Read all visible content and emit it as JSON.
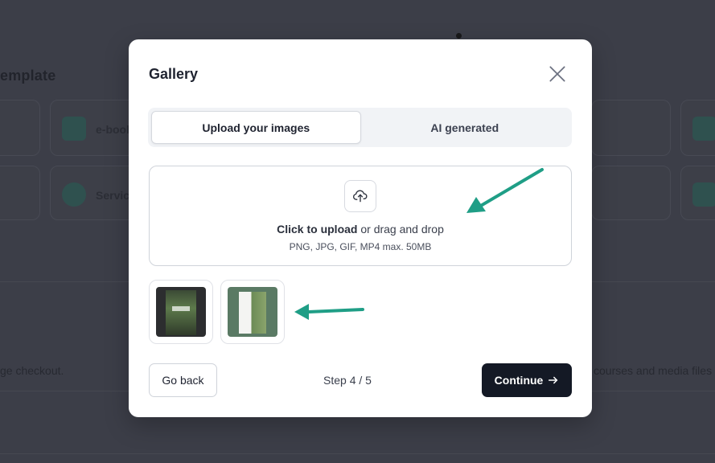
{
  "background": {
    "title": "emplate",
    "cards": [
      {
        "label": "e-book",
        "icon": "pdf-icon"
      },
      {
        "label": "Servic",
        "icon": "dollar-icon"
      }
    ],
    "left_text": "ge checkout.",
    "right_text": "courses and media files"
  },
  "modal": {
    "title": "Gallery",
    "close_icon": "close-icon",
    "tabs": [
      {
        "label": "Upload your images",
        "active": true
      },
      {
        "label": "AI generated",
        "active": false
      }
    ],
    "dropzone": {
      "icon": "cloud-upload-icon",
      "action_text": "Click to upload",
      "rest_text": " or drag and drop",
      "hint": "PNG, JPG, GIF, MP4 max. 50MB"
    },
    "thumbnails": [
      {
        "name": "uploaded-image-1"
      },
      {
        "name": "uploaded-image-2"
      }
    ],
    "footer": {
      "back_label": "Go back",
      "step_text": "Step 4 / 5",
      "continue_label": "Continue",
      "continue_icon": "arrow-right-icon"
    }
  },
  "colors": {
    "primary_button": "#141925",
    "annotation_arrow": "#1f9e86",
    "overlay": "#3f424c"
  }
}
